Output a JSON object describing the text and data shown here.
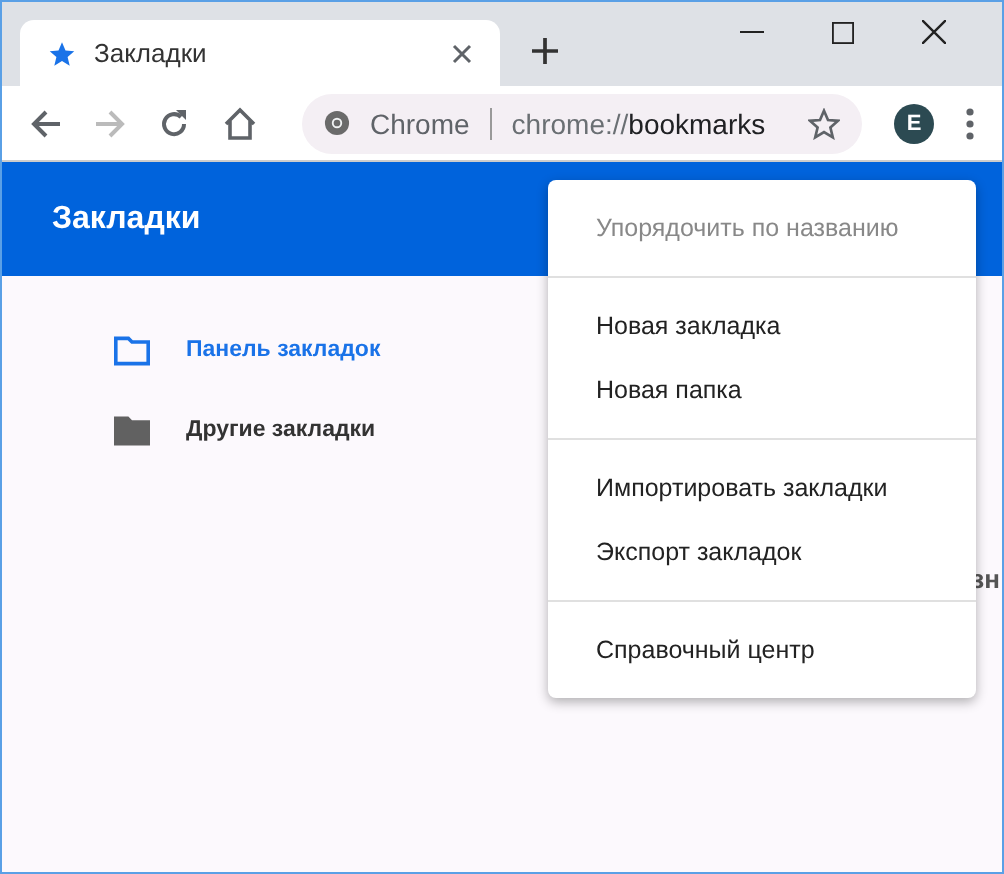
{
  "tabs": [
    {
      "title": "Закладки",
      "selected": true
    }
  ],
  "toolbar": {
    "back_disabled": false,
    "forward_disabled": true,
    "site_chip": "Chrome",
    "url_scheme": "chrome://",
    "url_rest": "bookmarks",
    "avatar": "E"
  },
  "header": {
    "title": "Закладки"
  },
  "folders": [
    {
      "name": "Панель закладок",
      "selected": true
    },
    {
      "name": "Другие закладки",
      "selected": false
    }
  ],
  "hidden_text": "зн",
  "menu": [
    {
      "kind": "item",
      "label": "Упорядочить по названию",
      "disabled": true
    },
    {
      "kind": "separator"
    },
    {
      "kind": "item",
      "label": "Новая закладка",
      "disabled": false
    },
    {
      "kind": "item",
      "label": "Новая папка",
      "disabled": false
    },
    {
      "kind": "separator"
    },
    {
      "kind": "item",
      "label": "Импортировать закладки",
      "disabled": false
    },
    {
      "kind": "item",
      "label": "Экспорт закладок",
      "disabled": false
    },
    {
      "kind": "separator"
    },
    {
      "kind": "item",
      "label": "Справочный центр",
      "disabled": false
    }
  ]
}
